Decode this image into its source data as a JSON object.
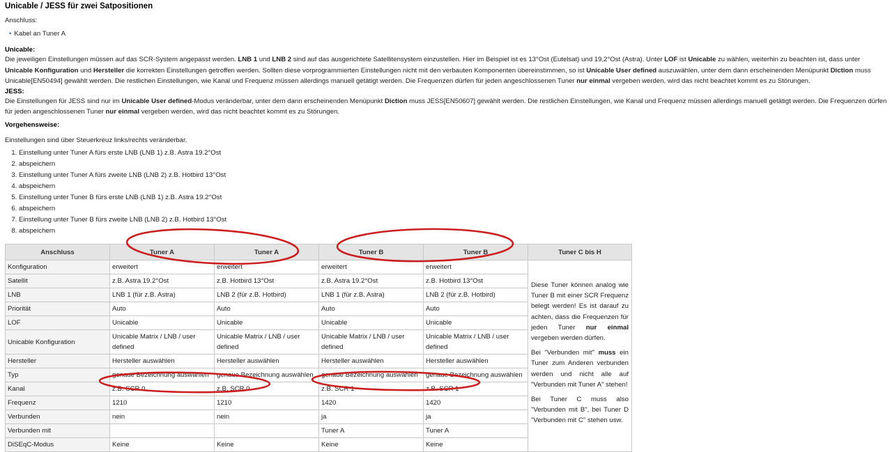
{
  "title": "Unicable / JESS für zwei Satpositionen",
  "connection_label": "Anschluss:",
  "connection_items": [
    "Kabel an Tuner A"
  ],
  "unicable": {
    "heading": "Unicable:",
    "text_parts": [
      {
        "t": "Die jeweiligen Einstellungen müssen auf das SCR-System angepasst werden. ",
        "b": false
      },
      {
        "t": "LNB 1",
        "b": true
      },
      {
        "t": " und ",
        "b": false
      },
      {
        "t": "LNB 2",
        "b": true
      },
      {
        "t": " sind auf das ausgerichtete Satellitensystem einzustellen. Hier im Beispiel ist es 13°Ost (Eutelsat) und 19,2°Ost (Astra). Unter ",
        "b": false
      },
      {
        "t": "LOF",
        "b": true
      },
      {
        "t": " ist ",
        "b": false
      },
      {
        "t": "Unicable",
        "b": true
      },
      {
        "t": " zu wählen, weiterhin zu beachten ist, dass unter ",
        "b": false
      },
      {
        "t": "Unicable Konfiguration",
        "b": true
      },
      {
        "t": " und ",
        "b": false
      },
      {
        "t": "Hersteller",
        "b": true
      },
      {
        "t": " die korrekten Einstellungen getroffen werden. Sollten diese vorprogrammierten Einstellungen nicht mit den verbauten Komponenten übereinstimmen, so ist ",
        "b": false
      },
      {
        "t": "Unicable User defined",
        "b": true
      },
      {
        "t": " auszuwählen, unter dem dann erscheinenden Menüpunkt ",
        "b": false
      },
      {
        "t": "Diction",
        "b": true
      },
      {
        "t": " muss Unicable[EN50494] gewählt werden. Die restlichen Einstellungen, wie Kanal und Frequenz müssen allerdings manuell getätigt werden. Die Frequenzen dürfen für jeden angeschlossenen Tuner ",
        "b": false
      },
      {
        "t": "nur einmal",
        "b": true
      },
      {
        "t": " vergeben werden, wird das nicht beachtet kommt es zu Störungen.",
        "b": false
      }
    ]
  },
  "jess": {
    "heading": "JESS:",
    "text_parts": [
      {
        "t": "Die Einstellungen für JESS sind nur im ",
        "b": false
      },
      {
        "t": "Unicable User defined",
        "b": true
      },
      {
        "t": "-Modus veränderbar, unter dem dann erscheinenden Menüpunkt ",
        "b": false
      },
      {
        "t": "Diction",
        "b": true
      },
      {
        "t": " muss JESS[EN50607] gewählt werden. Die restlichen Einstellungen, wie Kanal und Frequenz müssen allerdings manuell getätigt werden. Die Frequenzen dürfen für jeden angeschlossenen Tuner ",
        "b": false
      },
      {
        "t": "nur einmal",
        "b": true
      },
      {
        "t": " vergeben werden, wird das nicht beachtet kommt es zu Störungen.",
        "b": false
      }
    ]
  },
  "procedure": {
    "heading": "Vorgehensweise:",
    "intro": "Einstellungen sind über Steuerkreuz links/rechts veränderbar.",
    "steps": [
      "Einstellung unter Tuner A fürs erste LNB (LNB 1) z.B. Astra 19.2°Ost",
      "abspeichern",
      "Einstellung unter Tuner A fürs zweite LNB (LNB 2) z.B. Hotbird 13°Ost",
      "abspeichern",
      "Einstellung unter Tuner B fürs erste LNB (LNB 1) z.B. Astra 19.2°Ost",
      "abspeichern",
      "Einstellung unter Tuner B fürs zweite LNB (LNB 2) z.B. Hotbird 13°Ost",
      "abspeichern"
    ]
  },
  "table": {
    "headers": [
      "Anschluss",
      "Tuner A",
      "Tuner A",
      "Tuner B",
      "Tuner B",
      "Tuner C bis H"
    ],
    "rows": [
      {
        "label": "Konfiguration",
        "cells": [
          "erweitert",
          "erweitert",
          "erweitert",
          "erweitert"
        ]
      },
      {
        "label": "Satellit",
        "cells": [
          "z.B. Astra 19.2°Ost",
          "z.B. Hotbird 13°Ost",
          "z.B. Astra 19.2°Ost",
          "z.B. Hotbird 13°Ost"
        ]
      },
      {
        "label": "LNB",
        "cells": [
          "LNB 1 (für z.B. Astra)",
          "LNB 2 (für z.B. Hotbird)",
          "LNB 1 (für z.B. Astra)",
          "LNB 2 (für z.B. Hotbird)"
        ]
      },
      {
        "label": "Priorität",
        "cells": [
          "Auto",
          "Auto",
          "Auto",
          "Auto"
        ]
      },
      {
        "label": "LOF",
        "cells": [
          "Unicable",
          "Unicable",
          "Unicable",
          "Unicable"
        ]
      },
      {
        "label": "Unicable Konfiguration",
        "cells": [
          "Unicable Matrix / LNB / user defined",
          "Unicable Matrix / LNB / user defined",
          "Unicable Matrix / LNB / user defined",
          "Unicable Matrix / LNB / user defined"
        ]
      },
      {
        "label": "Hersteller",
        "cells": [
          "Hersteller auswählen",
          "Hersteller auswählen",
          "Hersteller auswählen",
          "Hersteller auswählen"
        ]
      },
      {
        "label": "Typ",
        "cells": [
          "genaue Bezeichnung auswählen",
          "genaue Bezeichnung auswählen",
          "genaue Bezeichnung auswählen",
          "genaue Bezeichnung auswählen"
        ]
      },
      {
        "label": "Kanal",
        "cells": [
          "z.B. SCR 0",
          "z.B. SCR 0",
          "z.B. SCR 1",
          "z.B. SCR 1"
        ]
      },
      {
        "label": "Frequenz",
        "cells": [
          "1210",
          "1210",
          "1420",
          "1420"
        ]
      },
      {
        "label": "Verbunden",
        "cells": [
          "nein",
          "nein",
          "ja",
          "ja"
        ]
      },
      {
        "label": "Verbunden mit",
        "cells": [
          "",
          "",
          "Tuner A",
          "Tuner A"
        ]
      },
      {
        "label": "DiSEqC-Modus",
        "cells": [
          "Keine",
          "Keine",
          "Keine",
          "Keine"
        ]
      }
    ],
    "side_paragraphs": [
      [
        {
          "t": "Diese Tuner können analog wie Tuner B mit einer SCR Frequenz belegt werden! Es ist darauf zu achten, dass die Frequenzen für jeden Tuner ",
          "b": false
        },
        {
          "t": "nur einmal",
          "b": true
        },
        {
          "t": " vergeben werden dürfen.",
          "b": false
        }
      ],
      [
        {
          "t": "Bei \"Verbunden mit\" ",
          "b": false
        },
        {
          "t": "muss",
          "b": true
        },
        {
          "t": " ein Tuner zum Anderen verbunden werden und nicht alle auf \"Verbunden mit Tuner A\" stehen!",
          "b": false
        }
      ],
      [
        {
          "t": "Bei Tuner C muss also \"Verbunden mit B\", bei Tuner D \"Verbunden mit C\" stehen usw.",
          "b": false
        }
      ]
    ]
  },
  "annotation_color": "#cc1f1f"
}
